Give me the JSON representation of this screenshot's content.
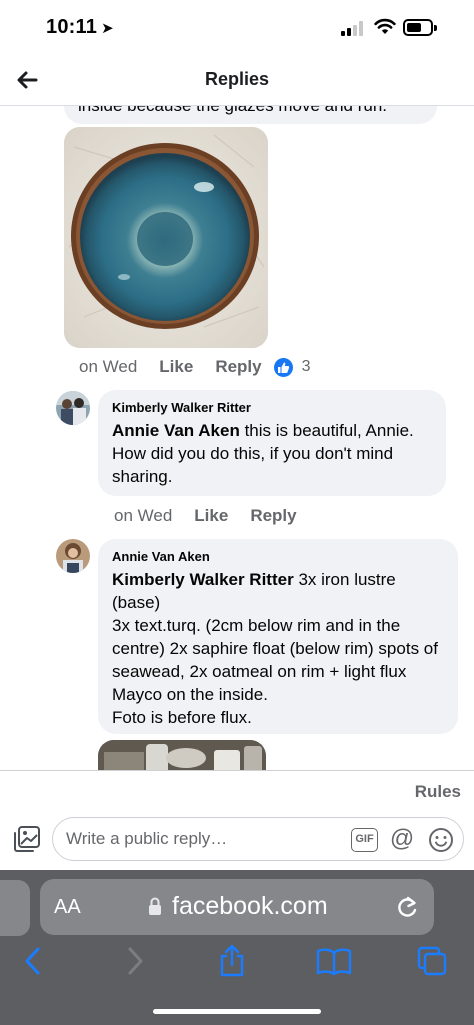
{
  "status_bar": {
    "time": "10:11",
    "location_arrow": "location-arrow-icon"
  },
  "header": {
    "title": "Replies",
    "back_icon": "arrow-left-icon"
  },
  "cutoff_comment": {
    "text": "inside because the glazes move and run."
  },
  "top_comment": {
    "timestamp": "on Wed",
    "like_label": "Like",
    "reply_label": "Reply",
    "reaction_count": "3"
  },
  "replies": [
    {
      "author": "Kimberly Walker Ritter",
      "mention": "Annie Van Aken",
      "text": " this is beautiful, Annie. How did you do this, if you don't mind sharing.",
      "timestamp": "on Wed",
      "like_label": "Like",
      "reply_label": "Reply"
    },
    {
      "author": "Annie Van Aken",
      "mention": "Kimberly Walker Ritter",
      "text": " 3x iron lustre (base)",
      "lines": [
        "3x text.turq. (2cm below rim and in the centre) 2x saphire float (below rim) spots of seawead, 2x oatmeal on rim + light flux Mayco on the inside.",
        "Foto is before flux."
      ]
    }
  ],
  "reply_bar": {
    "rules_label": "Rules",
    "placeholder": "Write a public reply…",
    "gif_label": "GIF",
    "at_symbol": "@"
  },
  "browser": {
    "aa_label": "AA",
    "url": "facebook.com"
  },
  "colors": {
    "accent": "#1877f2",
    "bubble": "#f0f2f5",
    "secondary_text": "#65676b",
    "safari_bar": "#5d5e62",
    "safari_icons": "#1a7cff"
  }
}
